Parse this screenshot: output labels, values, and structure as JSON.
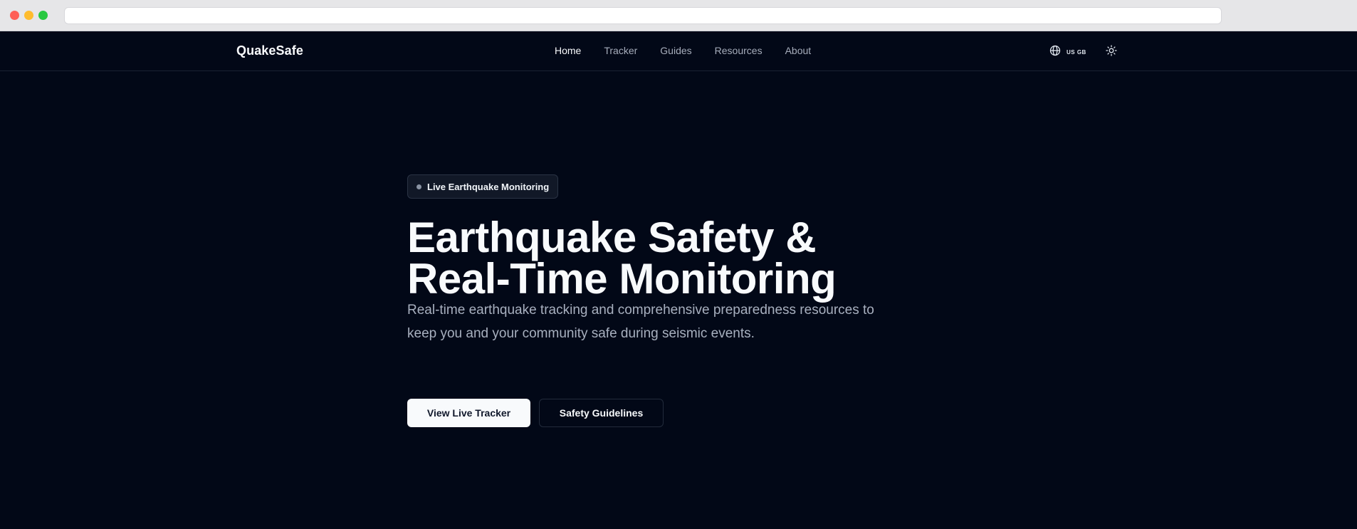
{
  "site": {
    "brand": "QuakeSafe",
    "nav": [
      {
        "label": "Home",
        "active": true
      },
      {
        "label": "Tracker",
        "active": false
      },
      {
        "label": "Guides",
        "active": false
      },
      {
        "label": "Resources",
        "active": false
      },
      {
        "label": "About",
        "active": false
      }
    ],
    "language": {
      "codes": "US GB",
      "icon": "globe-icon"
    },
    "theme_toggle": {
      "icon": "sun-icon"
    }
  },
  "hero": {
    "badge": "Live Earthquake Monitoring",
    "headline_line1": "Earthquake Safety &",
    "headline_line2": "Real-Time Monitoring",
    "subtitle_line1": "Real-time earthquake tracking and comprehensive preparedness resources to",
    "subtitle_line2": "keep you and your community safe during seismic events.",
    "primary_button": "View Live Tracker",
    "secondary_button": "Safety Guidelines"
  },
  "colors": {
    "background": "#020817",
    "foreground": "#f8fafc",
    "muted": "#a8b0bf",
    "border": "#222b3b"
  }
}
